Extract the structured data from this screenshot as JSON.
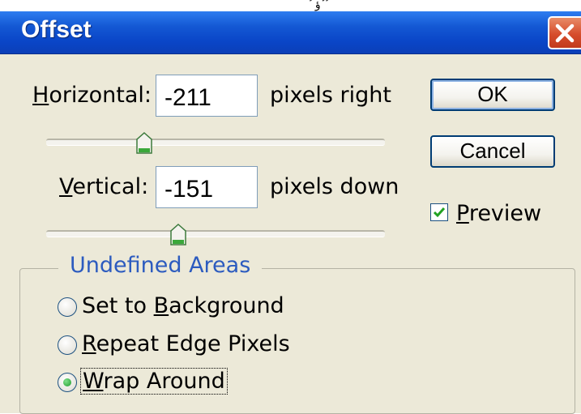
{
  "topstrip": {
    "text": "ٔ ٔ ؤ ٔ ٔ"
  },
  "window": {
    "title": "Offset"
  },
  "horizontal": {
    "label_underlined": "H",
    "label_rest": "orizontal:",
    "value": "-211",
    "unit": "pixels right",
    "slider_position_fraction": 0.29
  },
  "vertical": {
    "label_underlined": "V",
    "label_rest": "ertical:",
    "value": "-151",
    "unit": "pixels down",
    "slider_position_fraction": 0.39
  },
  "buttons": {
    "ok": "OK",
    "cancel": "Cancel"
  },
  "preview": {
    "label_underlined": "P",
    "label_rest": "review",
    "checked": true
  },
  "undefined_areas": {
    "legend": "Undefined Areas",
    "options": [
      {
        "pre": "Set to ",
        "underlined": "B",
        "post": "ackground",
        "selected": false
      },
      {
        "pre": "",
        "underlined": "R",
        "post": "epeat Edge Pixels",
        "selected": false
      },
      {
        "pre": "",
        "underlined": "W",
        "post": "rap Around",
        "selected": true
      }
    ]
  },
  "colors": {
    "titlebar": "#0a46c8",
    "dialog_bg": "#ece9d8",
    "groupbox_legend": "#2c5bbf",
    "close_button": "#d64d2c"
  }
}
